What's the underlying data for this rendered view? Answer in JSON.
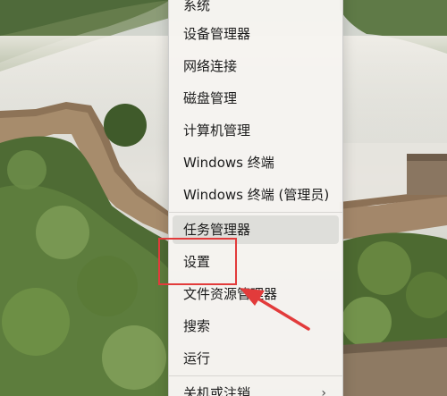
{
  "context_menu": {
    "items": [
      {
        "label": "系统"
      },
      {
        "label": "设备管理器"
      },
      {
        "label": "网络连接"
      },
      {
        "label": "磁盘管理"
      },
      {
        "label": "计算机管理"
      },
      {
        "label": "Windows 终端"
      },
      {
        "label": "Windows 终端 (管理员)"
      },
      {
        "label": "任务管理器"
      },
      {
        "label": "设置"
      },
      {
        "label": "文件资源管理器"
      },
      {
        "label": "搜索"
      },
      {
        "label": "运行"
      },
      {
        "label": "关机或注销",
        "submenu_icon": "chevron-right-icon",
        "submenu_glyph": "›"
      }
    ],
    "hovered_item": "任务管理器"
  },
  "annotation": {
    "highlighted_item": "设置",
    "color": "#e23b3b"
  },
  "colors": {
    "menu_background": "#f6f4f0",
    "menu_text": "#1c1c1c",
    "hover_background": "#dcdcd8",
    "annotation": "#e23b3b"
  }
}
